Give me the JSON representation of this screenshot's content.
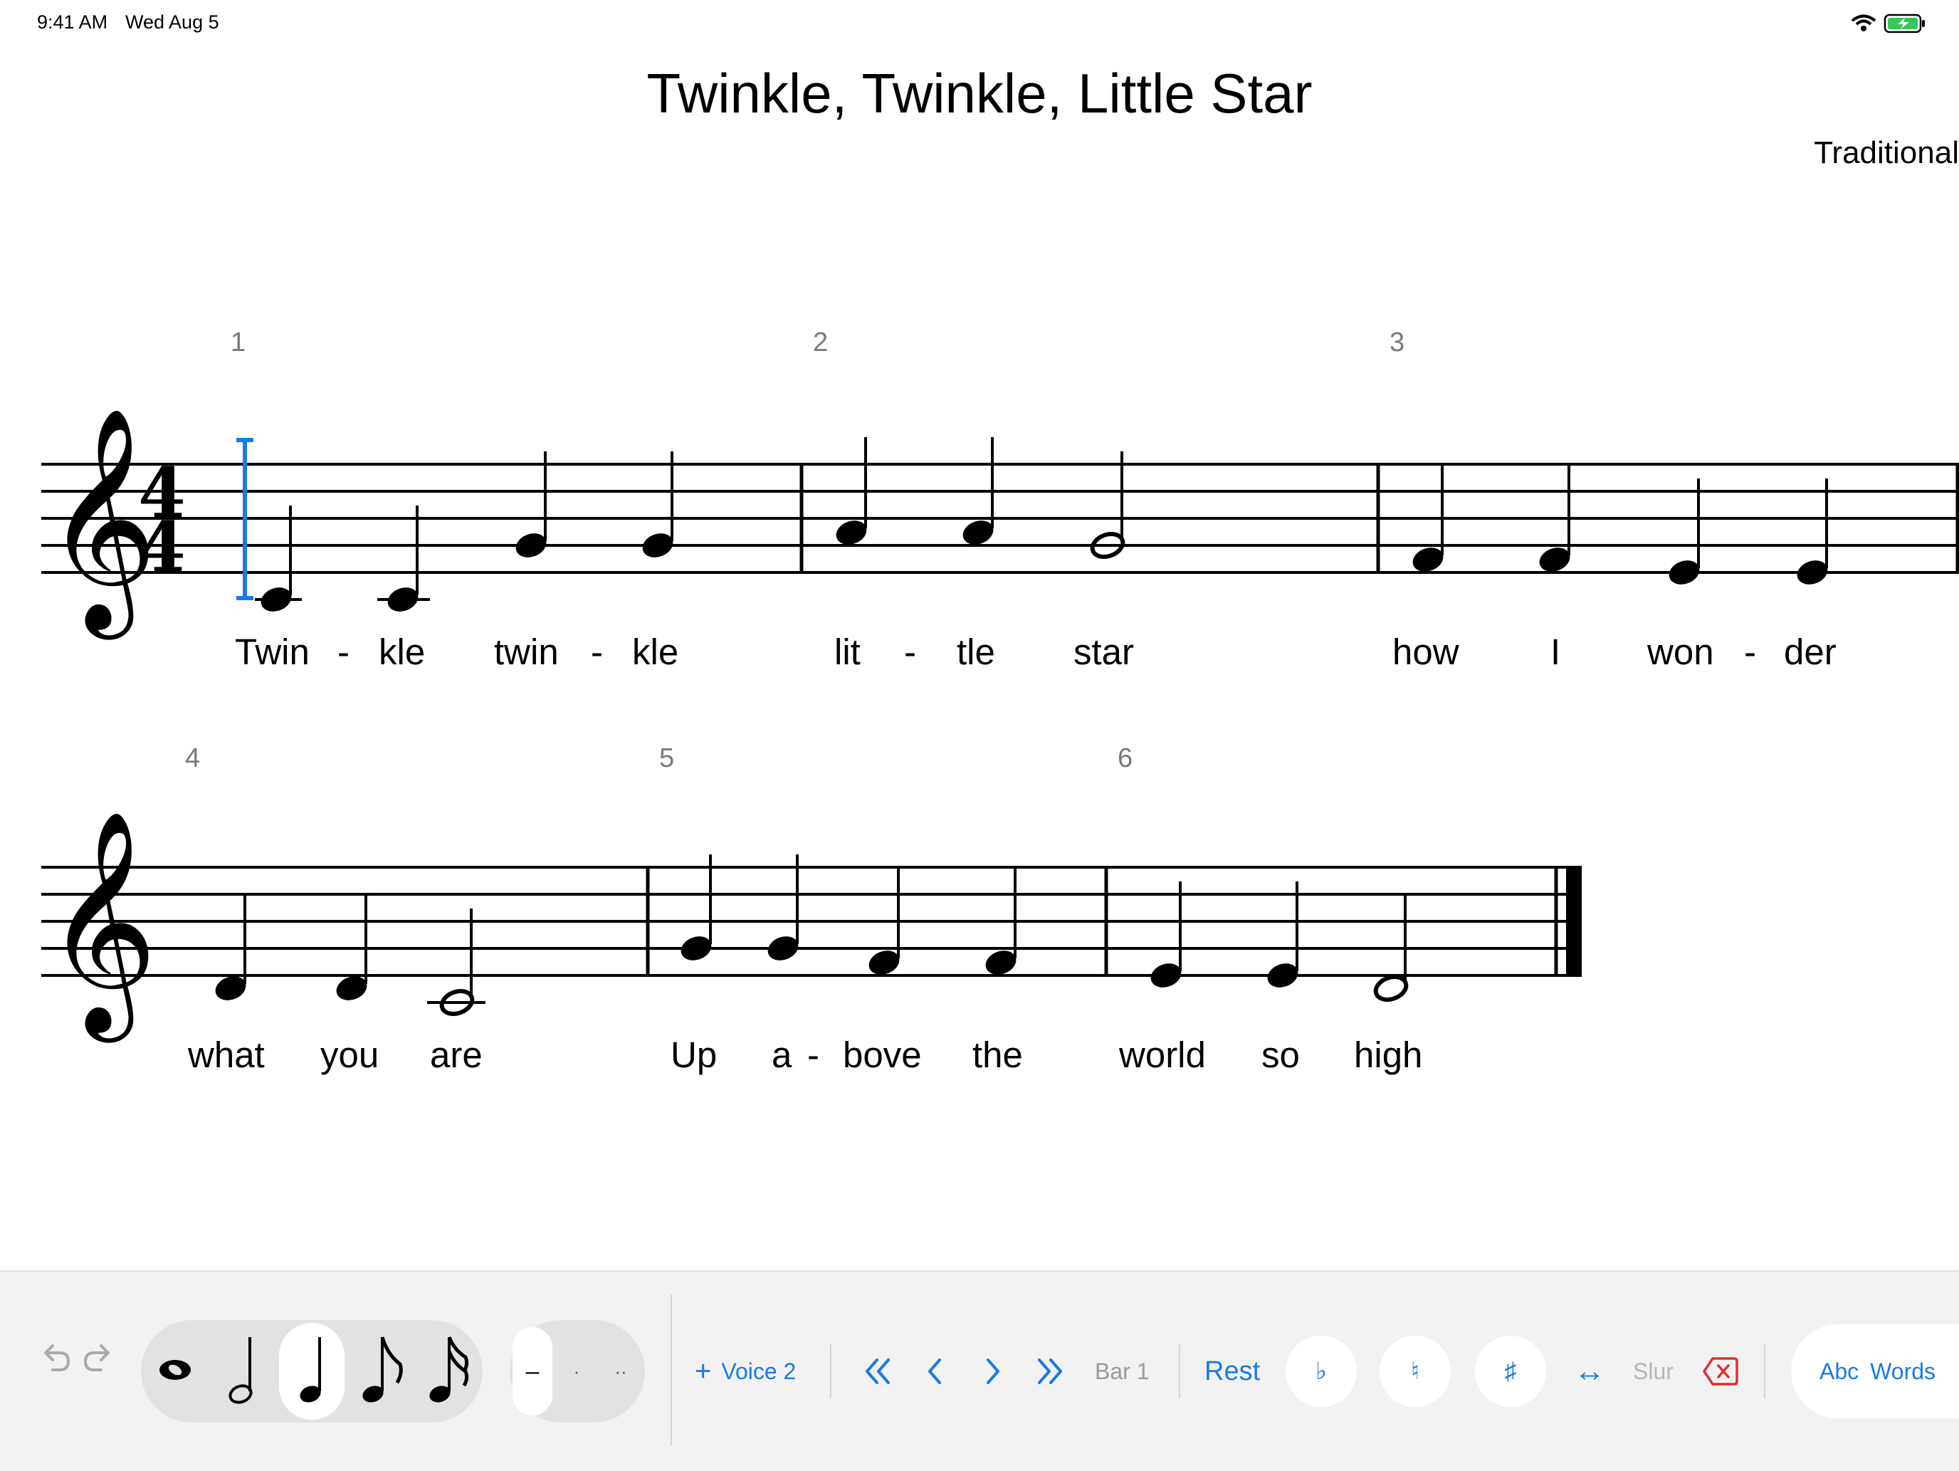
{
  "status_bar": {
    "time": "9:41 AM",
    "date": "Wed Aug 5"
  },
  "score": {
    "title": "Twinkle, Twinkle, Little Star",
    "composer": "Traditional",
    "time_signature": {
      "top": "4",
      "bottom": "4"
    },
    "measure_numbers": [
      "1",
      "2",
      "3",
      "4",
      "5",
      "6"
    ],
    "lyrics": {
      "line1": [
        "Twin",
        "kle",
        "twin",
        "kle",
        "lit",
        "tle",
        "star",
        "how",
        "I",
        "won",
        "der"
      ],
      "line2": [
        "what",
        "you",
        "are",
        "Up",
        "a",
        "bove",
        "the",
        "world",
        "so",
        "high"
      ],
      "hyphen": "-"
    }
  },
  "toolbar": {
    "undo_icon": "undo-icon",
    "redo_icon": "redo-icon",
    "durations": [
      "whole",
      "half",
      "quarter",
      "eighth",
      "sixteenth"
    ],
    "selected_duration": "quarter",
    "dots": {
      "none": "–",
      "single": "·",
      "double": "··"
    },
    "voice2_plus": "+",
    "voice2_label": "Voice 2",
    "bar_label": "Bar 1",
    "rest_label": "Rest",
    "flat": "♭",
    "natural": "♮",
    "sharp": "♯",
    "flip_icon": "↔",
    "slur_label": "Slur",
    "abc_label": "Abc",
    "words_label": "Words",
    "accent_color": "#1a7ae3"
  }
}
